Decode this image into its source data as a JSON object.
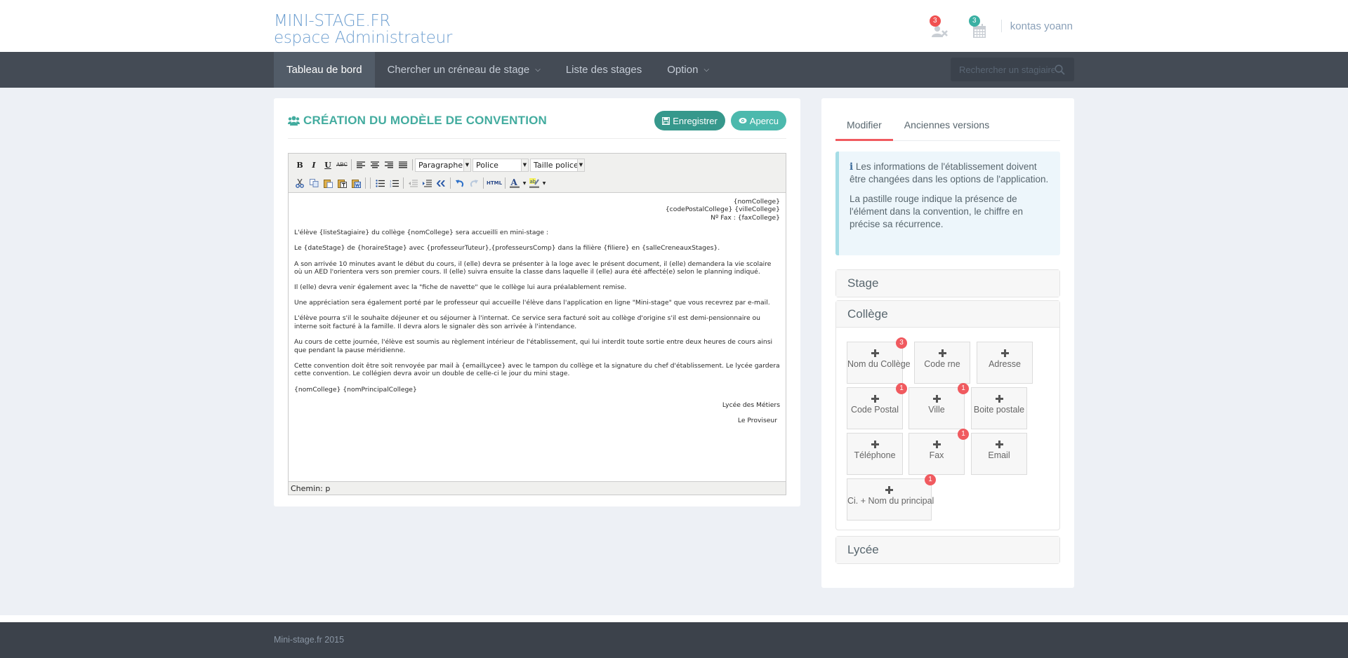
{
  "brand": {
    "line1": "MINI-STAGE.FR",
    "line2": "espace Administrateur"
  },
  "header": {
    "notifications": [
      {
        "icon": "user-remove-icon",
        "count": "3",
        "color": "#f05050"
      },
      {
        "icon": "calendar-icon",
        "count": "3",
        "color": "#3ab0a3"
      }
    ],
    "username": "kontas yoann"
  },
  "nav": {
    "items": [
      {
        "label": "Tableau de bord",
        "active": true
      },
      {
        "label": "Chercher un créneau de stage",
        "dropdown": true
      },
      {
        "label": "Liste des stages"
      },
      {
        "label": "Option",
        "dropdown": true
      }
    ],
    "search_placeholder": "Rechercher un stagiaire"
  },
  "main": {
    "title": "CRÉATION DU MODÈLE DE CONVENTION",
    "save_label": "Enregistrer",
    "preview_label": "Apercu",
    "accent": "#43ac9f",
    "editor": {
      "toolbar": {
        "format_select": "Paragraphe",
        "font_select": "Police",
        "size_select": "Taille police",
        "bold": "B",
        "italic": "I",
        "underline": "U",
        "strike": "ABC",
        "html": "HTML"
      },
      "header_lines": [
        "{nomCollege}",
        "{codePostalCollege} {villeCollege}",
        "Nº Fax : {faxCollege}"
      ],
      "paragraphs": [
        "L'élève {listeStagiaire} du collège {nomCollege} sera accueilli en mini-stage :",
        "Le {dateStage} de {horaireStage} avec {professeurTuteur},{professeursComp}  dans la filière {filiere} en {salleCreneauxStages}.",
        "A son arrivée 10 minutes avant le début du cours, il (elle) devra se présenter à la loge avec le présent document, il (elle) demandera la vie scolaire où un AED l'orientera vers son premier cours. Il (elle) suivra ensuite la classe dans laquelle il (elle) aura été affecté(e) selon le planning indiqué.",
        "Il (elle) devra venir également avec la \"fiche de navette\" que le collège lui aura préalablement remise.",
        "Une appréciation sera également porté par le professeur qui accueille l'élève dans l'application en ligne \"Mini-stage\" que vous recevrez par e-mail.",
        "L'élève pourra s'il le souhaite déjeuner et ou séjourner à l'internat. Ce service sera facturé soit au collège d'origine s'il est demi-pensionnaire ou interne soit facturé à la famille. Il devra alors le signaler dès son arrivée à l'intendance.",
        "Au cours de cette journée, l'élève est soumis au règlement intérieur de l'établissement, qui lui interdit toute sortie entre deux heures de cours ainsi que pendant la pause méridienne.",
        "Cette convention doit être soit renvoyée par mail à {emailLycee} avec le tampon du collège et la signature du chef d'établissement. Le lycée gardera cette convention. Le collégien devra avoir un double de celle-ci le jour du mini stage.",
        "{nomCollege} {nomPrincipalCollege}"
      ],
      "signature_lines": [
        "Lycée des Métiers",
        "Le Proviseur"
      ],
      "path_label": "Chemin: p"
    }
  },
  "sidebar": {
    "tabs": [
      {
        "label": "Modifier",
        "active": true
      },
      {
        "label": "Anciennes versions"
      }
    ],
    "info": [
      "Les informations de l'établissement doivent être changées dans les options de l'application.",
      "La pastille rouge indique la présence de l'élément dans la convention, le chiffre en précise sa récurrence."
    ],
    "sections": [
      {
        "label": "Stage",
        "expanded": false
      },
      {
        "label": "Collège",
        "expanded": true
      },
      {
        "label": "Lycée",
        "expanded": false
      }
    ],
    "college_fields": [
      {
        "label": "Nom du Collège",
        "count": "3"
      },
      {
        "label": "Code rne",
        "count": null
      },
      {
        "label": "Adresse",
        "count": null
      },
      {
        "label": "Code Postal",
        "count": "1"
      },
      {
        "label": "Ville",
        "count": "1"
      },
      {
        "label": "Boite postale",
        "count": null
      },
      {
        "label": "Téléphone",
        "count": null
      },
      {
        "label": "Fax",
        "count": "1"
      },
      {
        "label": "Email",
        "count": null
      },
      {
        "label": "Ci. + Nom du principal",
        "count": "1"
      }
    ],
    "badge_color": "#f05a5f"
  },
  "footer": {
    "text": "Mini-stage.fr 2015"
  }
}
